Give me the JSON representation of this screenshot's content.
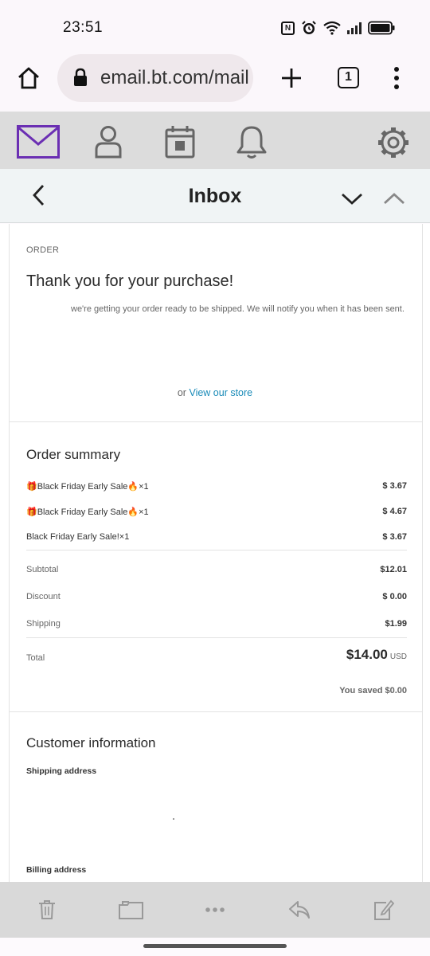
{
  "status_bar": {
    "time": "23:51",
    "nfc_label": "N"
  },
  "browser": {
    "url": "email.bt.com/mail",
    "tab_count": "1"
  },
  "inbox_bar": {
    "title": "Inbox"
  },
  "email": {
    "order_label": "ORDER",
    "heading": "Thank you for your purchase!",
    "ready_text": "we're getting your order ready to be shipped. We will notify you when it has been sent.",
    "store_prefix": "or ",
    "store_link": "View our store",
    "summary_title": "Order summary",
    "items": [
      {
        "gift": "🎁",
        "name": "Black Friday Early Sale",
        "fire": "🔥",
        "qty": "×1",
        "price": "$ 3.67"
      },
      {
        "gift": "🎁",
        "name": "Black Friday Early Sale",
        "fire": "🔥",
        "qty": "×1",
        "price": "$ 4.67"
      },
      {
        "gift": "",
        "name": "Black Friday Early Sale!",
        "fire": "",
        "qty": "×1",
        "price": "$ 3.67"
      }
    ],
    "subtotal_label": "Subtotal",
    "subtotal_value": "$12.01",
    "discount_label": "Discount",
    "discount_value": "$ 0.00",
    "shipping_label": "Shipping",
    "shipping_value": "$1.99",
    "total_label": "Total",
    "total_value": "$14.00",
    "total_currency": "USD",
    "saved_text": "You saved $0.00",
    "customer_title": "Customer information",
    "shipping_address_label": "Shipping address",
    "billing_address_label": "Billing address"
  },
  "colors": {
    "mail_accent": "#6b2fb3",
    "link": "#1a8bb8"
  },
  "icons": {
    "browser": [
      "home-icon",
      "lock-icon",
      "new-tab-icon",
      "tab-switcher-icon",
      "more-vert-icon"
    ],
    "toolbar": [
      "mail-icon",
      "contacts-icon",
      "calendar-icon",
      "notifications-icon",
      "settings-icon"
    ],
    "bottom": [
      "delete-icon",
      "move-folder-icon",
      "more-horiz-icon",
      "reply-icon",
      "compose-icon"
    ]
  }
}
